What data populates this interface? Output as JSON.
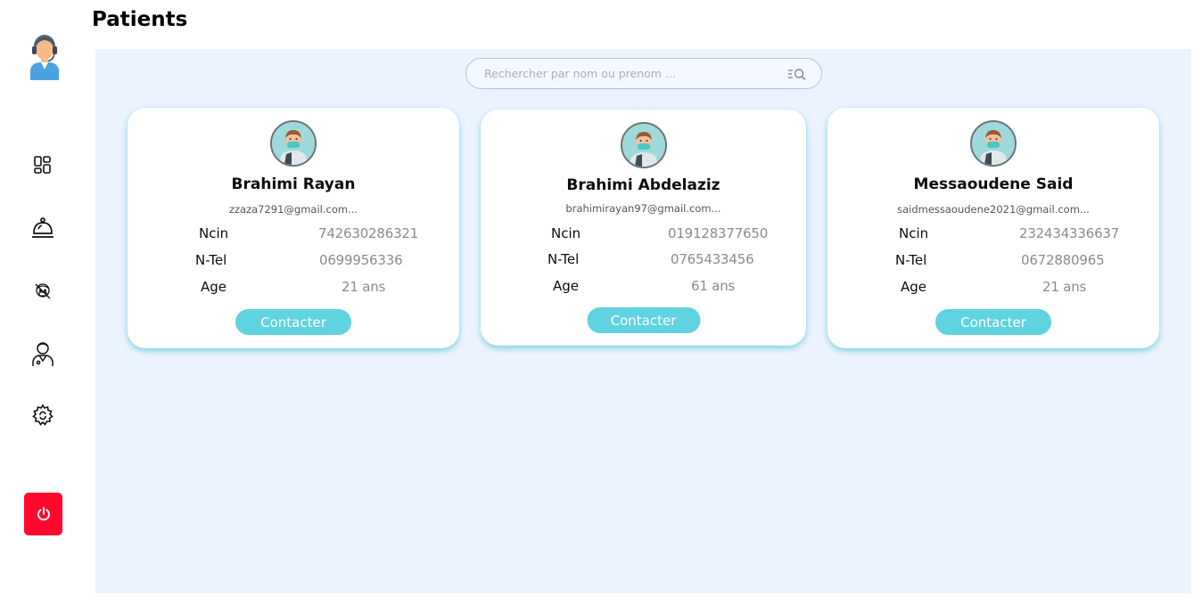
{
  "page": {
    "title": "Patients"
  },
  "sidebar": {
    "avatar_icon": "receptionist-avatar-icon",
    "items": [
      {
        "name": "dashboard",
        "icon": "dashboard-grid-icon"
      },
      {
        "name": "reception",
        "icon": "service-bell-icon"
      },
      {
        "name": "patients",
        "icon": "patient-face-icon"
      },
      {
        "name": "doctors",
        "icon": "doctor-icon"
      },
      {
        "name": "settings",
        "icon": "gear-icon"
      }
    ],
    "logout_icon": "power-icon",
    "logout_color": "#ff0a2d"
  },
  "search": {
    "placeholder": "Rechercher par nom ou prenom ..."
  },
  "labels": {
    "ncin": "Ncin",
    "ntel": "N-Tel",
    "age": "Age",
    "contact": "Contacter"
  },
  "patients": [
    {
      "name": "Brahimi Rayan",
      "email": "zzaza7291@gmail.com...",
      "ncin": "742630286321",
      "ntel": "0699956336",
      "age": "21 ans"
    },
    {
      "name": "Brahimi Abdelaziz",
      "email": "brahimirayan97@gmail.com...",
      "ncin": "019128377650",
      "ntel": "0765433456",
      "age": "61 ans"
    },
    {
      "name": "Messaoudene Said",
      "email": "saidmessaoudene2021@gmail.com...",
      "ncin": "232434336637",
      "ntel": "0672880965",
      "age": "21 ans"
    }
  ],
  "colors": {
    "accent": "#5fd3e0",
    "content_bg": "#ebf3fe",
    "danger": "#ff0a2d"
  }
}
